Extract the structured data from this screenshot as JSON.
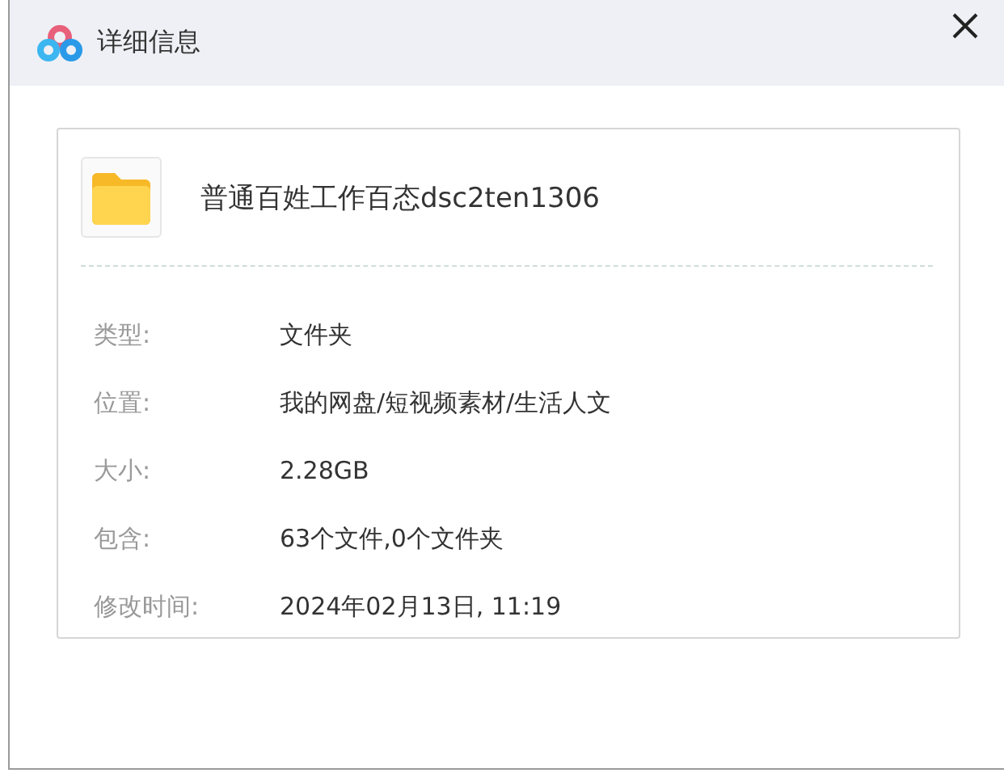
{
  "window": {
    "title": "详细信息"
  },
  "file": {
    "name": "普通百姓工作百态dsc2ten1306"
  },
  "details": [
    {
      "label": "类型:",
      "value": "文件夹"
    },
    {
      "label": "位置:",
      "value": "我的网盘/短视频素材/生活人文"
    },
    {
      "label": "大小:",
      "value": "2.28GB"
    },
    {
      "label": "包含:",
      "value": "63个文件,0个文件夹"
    },
    {
      "label": "修改时间:",
      "value": "2024年02月13日, 11:19"
    }
  ]
}
